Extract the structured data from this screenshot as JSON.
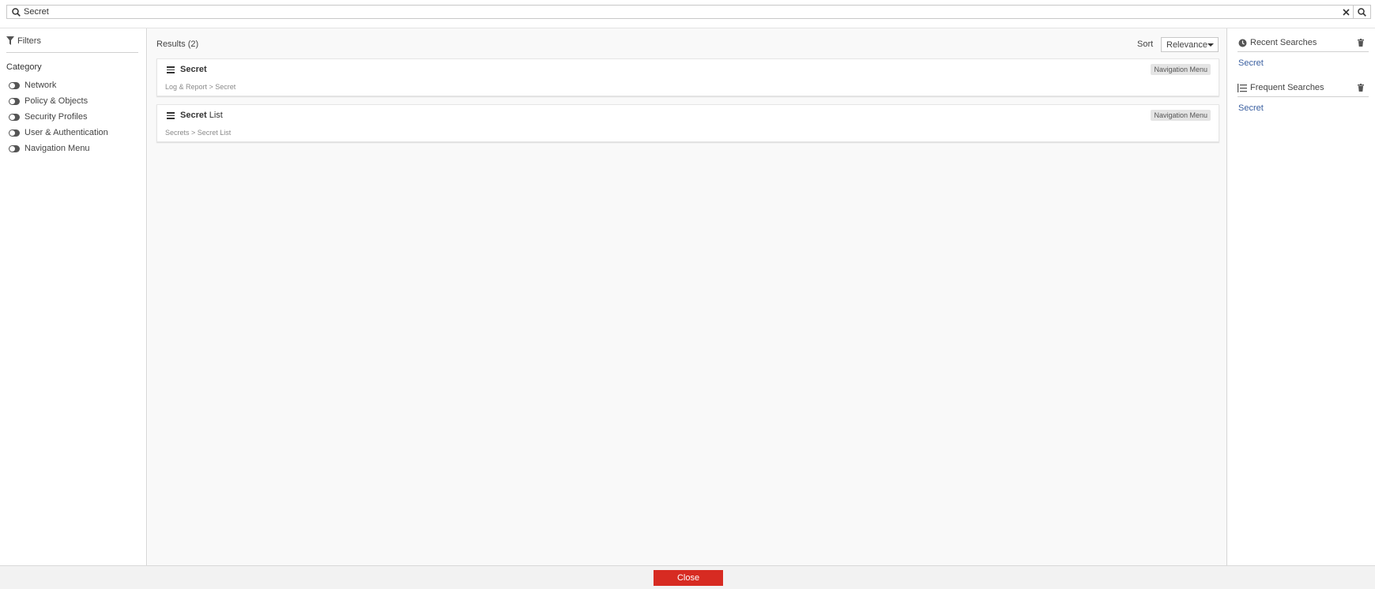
{
  "search": {
    "value": "Secret",
    "lead_icon": "search-icon",
    "clear_icon": "close-icon",
    "submit_icon": "search-icon"
  },
  "filters": {
    "title": "Filters",
    "icon": "filter-icon",
    "category_title": "Category",
    "categories": [
      {
        "label": "Network"
      },
      {
        "label": "Policy & Objects"
      },
      {
        "label": "Security Profiles"
      },
      {
        "label": "User & Authentication"
      },
      {
        "label": "Navigation Menu"
      }
    ]
  },
  "results": {
    "count_label": "Results (2)",
    "sort_label": "Sort",
    "sort_value": "Relevance",
    "items": [
      {
        "title_bold": "Secret",
        "title_rest": "",
        "path": "Log & Report > Secret",
        "badge": "Navigation Menu"
      },
      {
        "title_bold": "Secret",
        "title_rest": " List",
        "path": "Secrets > Secret List",
        "badge": "Navigation Menu"
      }
    ]
  },
  "recent": {
    "title": "Recent Searches",
    "icon": "clock-icon",
    "items": [
      "Secret"
    ]
  },
  "frequent": {
    "title": "Frequent Searches",
    "icon": "ordered-list-icon",
    "items": [
      "Secret"
    ]
  },
  "footer": {
    "close_label": "Close"
  },
  "colors": {
    "accent": "#d72b22",
    "link": "#3a5fa0",
    "panel_bg": "#f9f9f9"
  }
}
